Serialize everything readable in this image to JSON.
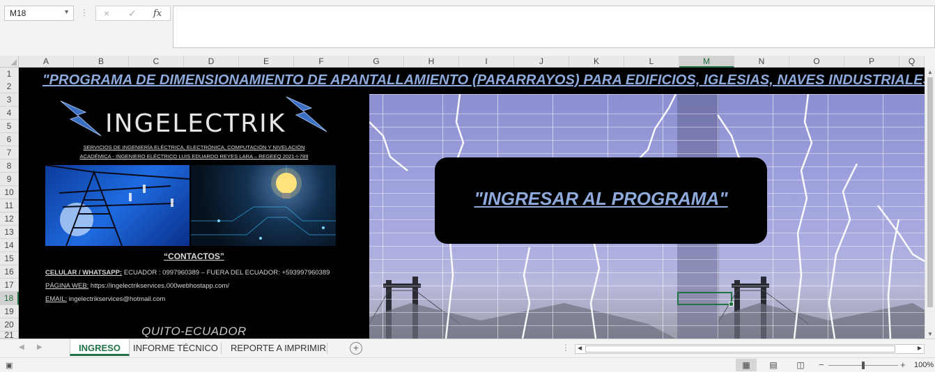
{
  "formula_bar": {
    "name_box": "M18",
    "cancel_icon": "×",
    "enter_icon": "✓",
    "fx_label": "fx",
    "formula": ""
  },
  "columns": [
    "A",
    "B",
    "C",
    "D",
    "E",
    "F",
    "G",
    "H",
    "I",
    "J",
    "K",
    "L",
    "M",
    "N",
    "O",
    "P",
    "Q"
  ],
  "selected_column": "M",
  "rows": [
    "1",
    "2",
    "3",
    "4",
    "5",
    "6",
    "7",
    "8",
    "9",
    "10",
    "11",
    "12",
    "13",
    "14",
    "15",
    "16",
    "17",
    "18",
    "19",
    "20",
    "21"
  ],
  "selected_row": "18",
  "sheet": {
    "title": "\"PROGRAMA DE DIMENSIONAMIENTO DE APANTALLAMIENTO (PARARRAYOS) PARA EDIFICIOS, IGLESIAS, NAVES INDUSTRIALES\"",
    "logo_text": "INGELECTRIK",
    "services_line1": "SERVICIOS DE INGENIERÍA ELÉCTRICA, ELECTRÓNICA, COMPUTACIÓN Y NIVELACIÓN",
    "services_line2": "ACADÉMICA - INGENIERO ELÉCTRICO LUIS EDUARDO REYES LARA – REGEEQ 2021-I-789",
    "contacts_title": "“CONTACTOS”",
    "phone_label": "CELULAR / WHATSAPP:",
    "phone_value": " ECUADOR : 0997960389 – FUERA DEL ECUADOR: +593997960389",
    "web_label": "PÁGINA WEB:",
    "web_value": "  https://ingelectrikservices.000webhostapp.com/",
    "email_label": "EMAIL:",
    "email_value": " ingelectrikservices@hotmail.com",
    "city": "QUITO-ECUADOR",
    "enter_button": "\"INGRESAR AL PROGRAMA\""
  },
  "tabs": {
    "items": [
      "INGRESO",
      "INFORME TÉCNICO",
      "REPORTE A IMPRIMIR"
    ],
    "active": "INGRESO",
    "add_sheet": "+"
  },
  "status_bar": {
    "zoom": "100%",
    "zoom_minus": "−",
    "zoom_plus": "+",
    "zoom_fraction": 0.5
  },
  "colors": {
    "accent": "#217346",
    "title_text": "#8ea9db",
    "panel": "#000000"
  }
}
